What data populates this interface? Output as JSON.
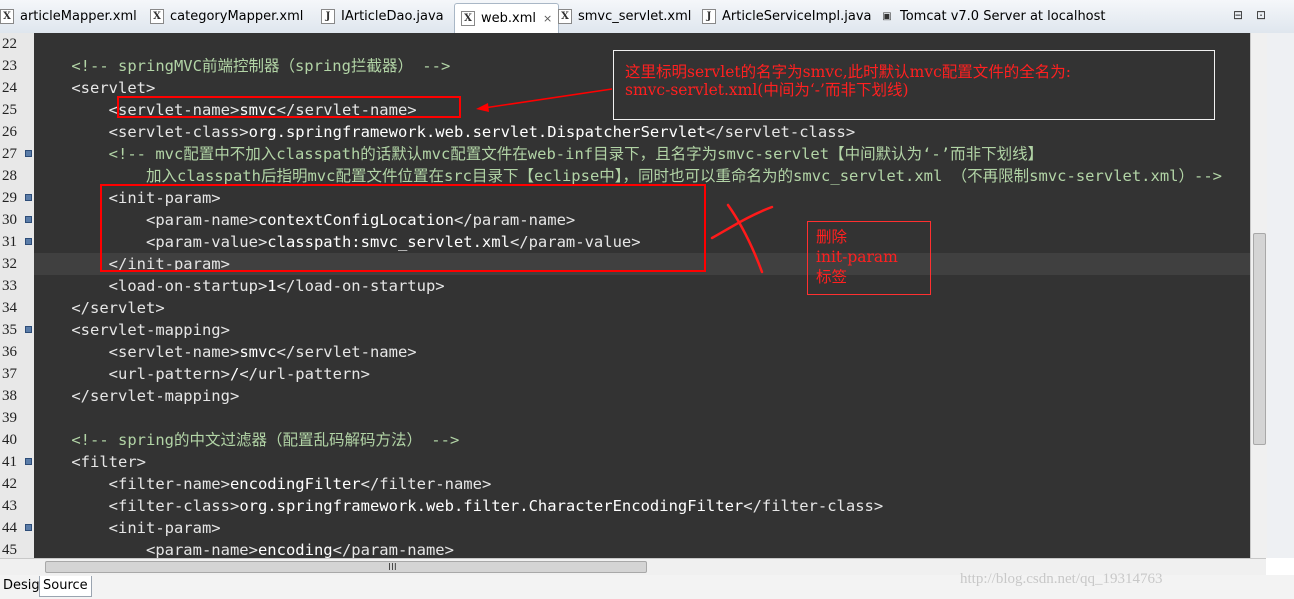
{
  "tabs": [
    {
      "label": "articleMapper.xml",
      "icon": "xml-file-icon",
      "active": false
    },
    {
      "label": "categoryMapper.xml",
      "icon": "xml-file-icon",
      "active": false
    },
    {
      "label": "IArticleDao.java",
      "icon": "java-interface-icon",
      "active": false
    },
    {
      "label": "web.xml",
      "icon": "xml-file-icon",
      "active": true,
      "close": "×"
    },
    {
      "label": "smvc_servlet.xml",
      "icon": "xml-file-icon",
      "active": false
    },
    {
      "label": "ArticleServiceImpl.java",
      "icon": "java-class-icon",
      "active": false
    },
    {
      "label": "Tomcat v7.0 Server at localhost",
      "icon": "server-icon",
      "active": false
    }
  ],
  "window_controls": {
    "minimize": "⊟",
    "maximize": "⊡"
  },
  "editor": {
    "highlighted_line": 32,
    "lines": [
      {
        "n": "22",
        "fold": false,
        "segments": []
      },
      {
        "n": "23",
        "fold": false,
        "segments": [
          {
            "c": "cm",
            "t": "    <!-- springMVC前端控制器（spring拦截器） -->"
          }
        ]
      },
      {
        "n": "24",
        "fold": false,
        "segments": [
          {
            "c": "tg",
            "t": "    <servlet>"
          }
        ]
      },
      {
        "n": "25",
        "fold": false,
        "segments": [
          {
            "c": "tg",
            "t": "        <servlet-name>"
          },
          {
            "c": "txt",
            "t": "smvc"
          },
          {
            "c": "tg",
            "t": "</servlet-name>"
          }
        ]
      },
      {
        "n": "26",
        "fold": false,
        "segments": [
          {
            "c": "tg",
            "t": "        <servlet-class>"
          },
          {
            "c": "txt",
            "t": "org.springframework.web.servlet.DispatcherServlet"
          },
          {
            "c": "tg",
            "t": "</servlet-class>"
          }
        ]
      },
      {
        "n": "27",
        "fold": true,
        "segments": [
          {
            "c": "cm",
            "t": "        <!-- mvc配置中不加入classpath的话默认mvc配置文件在web-inf目录下，且名字为smvc-servlet【中间默认为‘-’而非下划线】"
          }
        ]
      },
      {
        "n": "28",
        "fold": false,
        "segments": [
          {
            "c": "cm",
            "t": "            加入classpath后指明mvc配置文件位置在src目录下【eclipse中】，同时也可以重命名为的smvc_servlet.xml （不再限制smvc-servlet.xml）-->"
          }
        ]
      },
      {
        "n": "29",
        "fold": true,
        "segments": [
          {
            "c": "tg",
            "t": "        <init-param>"
          }
        ]
      },
      {
        "n": "30",
        "fold": true,
        "segments": [
          {
            "c": "tg",
            "t": "            <param-name>"
          },
          {
            "c": "txt",
            "t": "contextConfigLocation"
          },
          {
            "c": "tg",
            "t": "</param-name>"
          }
        ]
      },
      {
        "n": "31",
        "fold": true,
        "segments": [
          {
            "c": "tg",
            "t": "            <param-value>"
          },
          {
            "c": "txt",
            "t": "classpath:smvc_servlet.xml"
          },
          {
            "c": "tg",
            "t": "</param-value>"
          }
        ]
      },
      {
        "n": "32",
        "fold": false,
        "segments": [
          {
            "c": "tg",
            "t": "        </init-param>"
          }
        ]
      },
      {
        "n": "33",
        "fold": false,
        "segments": [
          {
            "c": "tg",
            "t": "        <load-on-startup>"
          },
          {
            "c": "txt",
            "t": "1"
          },
          {
            "c": "tg",
            "t": "</load-on-startup>"
          }
        ]
      },
      {
        "n": "34",
        "fold": false,
        "segments": [
          {
            "c": "tg",
            "t": "    </servlet>"
          }
        ]
      },
      {
        "n": "35",
        "fold": true,
        "segments": [
          {
            "c": "tg",
            "t": "    <servlet-mapping>"
          }
        ]
      },
      {
        "n": "36",
        "fold": false,
        "segments": [
          {
            "c": "tg",
            "t": "        <servlet-name>"
          },
          {
            "c": "txt",
            "t": "smvc"
          },
          {
            "c": "tg",
            "t": "</servlet-name>"
          }
        ]
      },
      {
        "n": "37",
        "fold": false,
        "segments": [
          {
            "c": "tg",
            "t": "        <url-pattern>"
          },
          {
            "c": "txt",
            "t": "/"
          },
          {
            "c": "tg",
            "t": "</url-pattern>"
          }
        ]
      },
      {
        "n": "38",
        "fold": false,
        "segments": [
          {
            "c": "tg",
            "t": "    </servlet-mapping>"
          }
        ]
      },
      {
        "n": "39",
        "fold": false,
        "segments": []
      },
      {
        "n": "40",
        "fold": false,
        "segments": [
          {
            "c": "cm",
            "t": "    <!-- spring的中文过滤器（配置乱码解码方法） -->"
          }
        ]
      },
      {
        "n": "41",
        "fold": true,
        "segments": [
          {
            "c": "tg",
            "t": "    <filter>"
          }
        ]
      },
      {
        "n": "42",
        "fold": false,
        "segments": [
          {
            "c": "tg",
            "t": "        <filter-name>"
          },
          {
            "c": "txt",
            "t": "encodingFilter"
          },
          {
            "c": "tg",
            "t": "</filter-name>"
          }
        ]
      },
      {
        "n": "43",
        "fold": false,
        "segments": [
          {
            "c": "tg",
            "t": "        <filter-class>"
          },
          {
            "c": "txt",
            "t": "org.springframework.web.filter.CharacterEncodingFilter"
          },
          {
            "c": "tg",
            "t": "</filter-class>"
          }
        ]
      },
      {
        "n": "44",
        "fold": true,
        "segments": [
          {
            "c": "tg",
            "t": "        <init-param>"
          }
        ]
      },
      {
        "n": "45",
        "fold": false,
        "segments": [
          {
            "c": "tg",
            "t": "            <param-name>"
          },
          {
            "c": "txt",
            "t": "encoding"
          },
          {
            "c": "tg",
            "t": "</param-name>"
          }
        ]
      }
    ]
  },
  "annotations": {
    "note1_line1": "这里标明servlet的名字为smvc,此时默认mvc配置文件的全名为:",
    "note1_line2": "smvc-servlet.xml(中间为‘-’而非下划线)",
    "note2_line1": "删除",
    "note2_line2": "init-param",
    "note2_line3": "标签",
    "accent_color": "#ff0000"
  },
  "scroll_grip": "III",
  "bottom_tabs": [
    {
      "label": "Design",
      "active": false
    },
    {
      "label": "Source",
      "active": true
    }
  ],
  "watermark": "http://blog.csdn.net/qq_19314763"
}
